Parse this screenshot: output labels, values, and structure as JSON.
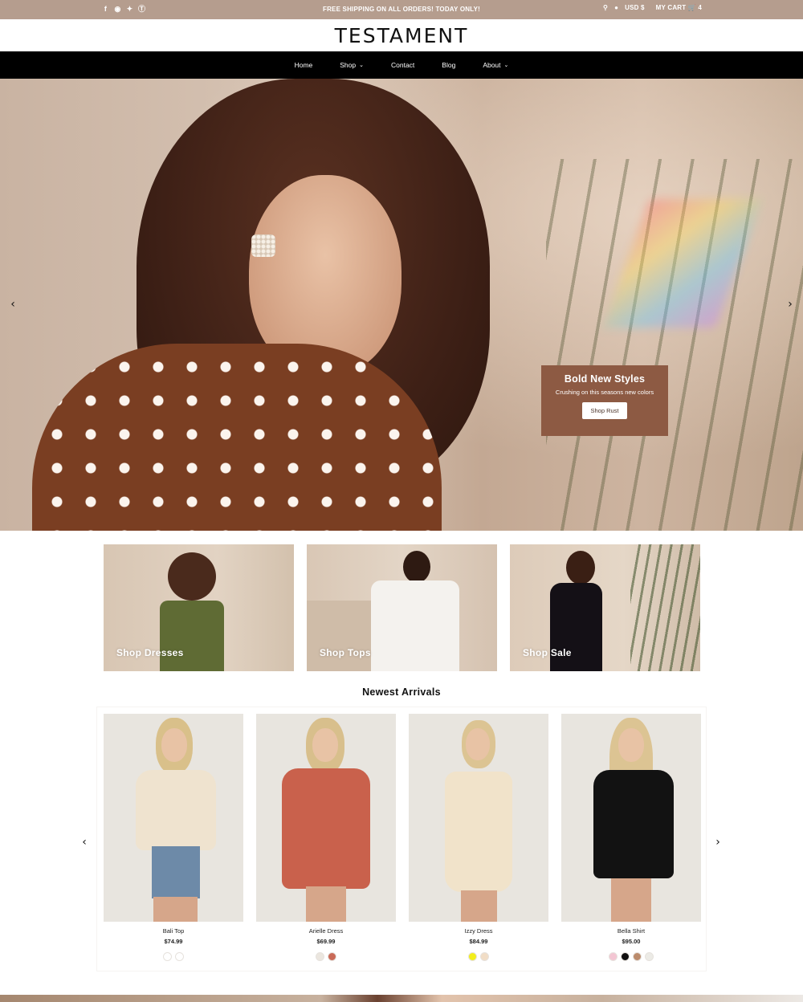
{
  "topbar": {
    "social_icons": [
      "facebook-icon",
      "instagram-icon",
      "twitter-icon",
      "pinterest-icon"
    ],
    "announcement": "FREE SHIPPING ON ALL ORDERS! TODAY ONLY!",
    "currency": "USD $",
    "cart_label": "MY CART",
    "cart_count": "4"
  },
  "header": {
    "logo": "TESTAMENT"
  },
  "nav": {
    "items": [
      {
        "label": "Home",
        "dropdown": false
      },
      {
        "label": "Shop",
        "dropdown": true
      },
      {
        "label": "Contact",
        "dropdown": false
      },
      {
        "label": "Blog",
        "dropdown": false
      },
      {
        "label": "About",
        "dropdown": true
      }
    ]
  },
  "hero": {
    "title": "Bold New Styles",
    "subtitle": "Crushing on this seasons new colors",
    "button": "Shop Rust",
    "promo_color": "#8d5a43"
  },
  "categories": [
    {
      "label": "Shop Dresses"
    },
    {
      "label": "Shop Tops"
    },
    {
      "label": "Shop Sale"
    }
  ],
  "newest": {
    "title": "Newest Arrivals",
    "products": [
      {
        "name": "Bali Top",
        "price": "$74.99",
        "swatches": [
          "#ffffff",
          "#ffffff"
        ]
      },
      {
        "name": "Arielle Dress",
        "price": "$69.99",
        "swatches": [
          "#ebe6df",
          "#c96a58"
        ]
      },
      {
        "name": "Izzy Dress",
        "price": "$84.99",
        "swatches": [
          "#f2ee1c",
          "#f1ddc6"
        ]
      },
      {
        "name": "Bella Shirt",
        "price": "$95.00",
        "swatches": [
          "#f3c6d3",
          "#111111",
          "#bb8b6c",
          "#ecebe6"
        ]
      }
    ]
  },
  "colors": {
    "topbar_bg": "#b59d8e",
    "nav_bg": "#000000"
  }
}
